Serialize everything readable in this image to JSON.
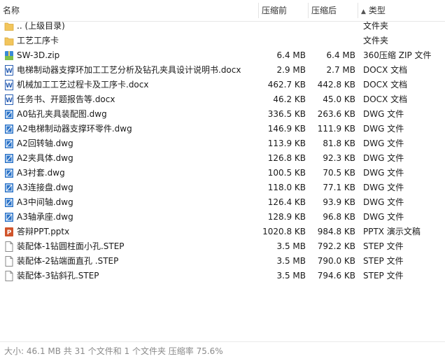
{
  "header": {
    "name": "名称",
    "original_size": "压缩前",
    "compressed_size": "压缩后",
    "type": "类型"
  },
  "files": [
    {
      "name": ".. (上级目录)",
      "original": "",
      "compressed": "",
      "type": "文件夹",
      "icon": "folder-icon"
    },
    {
      "name": "工艺工序卡",
      "original": "",
      "compressed": "",
      "type": "文件夹",
      "icon": "folder-icon"
    },
    {
      "name": "SW-3D.zip",
      "original": "6.4 MB",
      "compressed": "6.4 MB",
      "type": "360压缩 ZIP 文件",
      "icon": "zip-icon"
    },
    {
      "name": " 电梯制动器支撑环加工工艺分析及钻孔夹具设计说明书.docx",
      "original": "2.9 MB",
      "compressed": "2.7 MB",
      "type": "DOCX 文档",
      "icon": "docx-icon"
    },
    {
      "name": "机械加工工艺过程卡及工序卡.docx",
      "original": "462.7 KB",
      "compressed": "442.8 KB",
      "type": "DOCX 文档",
      "icon": "docx-icon"
    },
    {
      "name": "任务书、开题报告等.docx",
      "original": "46.2 KB",
      "compressed": "45.0 KB",
      "type": "DOCX 文档",
      "icon": "docx-icon"
    },
    {
      "name": "A0钻孔夹具装配图.dwg",
      "original": "336.5 KB",
      "compressed": "263.6 KB",
      "type": "DWG 文件",
      "icon": "dwg-icon"
    },
    {
      "name": "A2电梯制动器支撑环零件.dwg",
      "original": "146.9 KB",
      "compressed": "111.9 KB",
      "type": "DWG 文件",
      "icon": "dwg-icon"
    },
    {
      "name": "A2回转轴.dwg",
      "original": "113.9 KB",
      "compressed": "81.8 KB",
      "type": "DWG 文件",
      "icon": "dwg-icon"
    },
    {
      "name": "A2夹具体.dwg",
      "original": "126.8 KB",
      "compressed": "92.3 KB",
      "type": "DWG 文件",
      "icon": "dwg-icon"
    },
    {
      "name": "A3衬套.dwg",
      "original": "100.5 KB",
      "compressed": "70.5 KB",
      "type": "DWG 文件",
      "icon": "dwg-icon"
    },
    {
      "name": "A3连接盘.dwg",
      "original": "118.0 KB",
      "compressed": "77.1 KB",
      "type": "DWG 文件",
      "icon": "dwg-icon"
    },
    {
      "name": "A3中间轴.dwg",
      "original": "126.4 KB",
      "compressed": "93.9 KB",
      "type": "DWG 文件",
      "icon": "dwg-icon"
    },
    {
      "name": "A3轴承座.dwg",
      "original": "128.9 KB",
      "compressed": "96.8 KB",
      "type": "DWG 文件",
      "icon": "dwg-icon"
    },
    {
      "name": "答辩PPT.pptx",
      "original": "1020.8 KB",
      "compressed": "984.8 KB",
      "type": "PPTX 演示文稿",
      "icon": "pptx-icon"
    },
    {
      "name": "装配体-1钻圆柱面小孔.STEP",
      "original": "3.5 MB",
      "compressed": "792.2 KB",
      "type": "STEP 文件",
      "icon": "file-icon"
    },
    {
      "name": "装配体-2钻端面直孔 .STEP",
      "original": "3.5 MB",
      "compressed": "790.0 KB",
      "type": "STEP 文件",
      "icon": "file-icon"
    },
    {
      "name": "装配体-3钻斜孔.STEP",
      "original": "3.5 MB",
      "compressed": "794.6 KB",
      "type": "STEP 文件",
      "icon": "file-icon"
    }
  ],
  "status": {
    "text": "大小: 46.1 MB 共 31 个文件和 1 个文件夹 压缩率 75.6%"
  },
  "colors": {
    "folder": "#f2c55c",
    "docx": "#2b5fb3",
    "dwg": "#2a73c9",
    "pptx": "#d0542b",
    "zip": "#3a8ad6"
  }
}
